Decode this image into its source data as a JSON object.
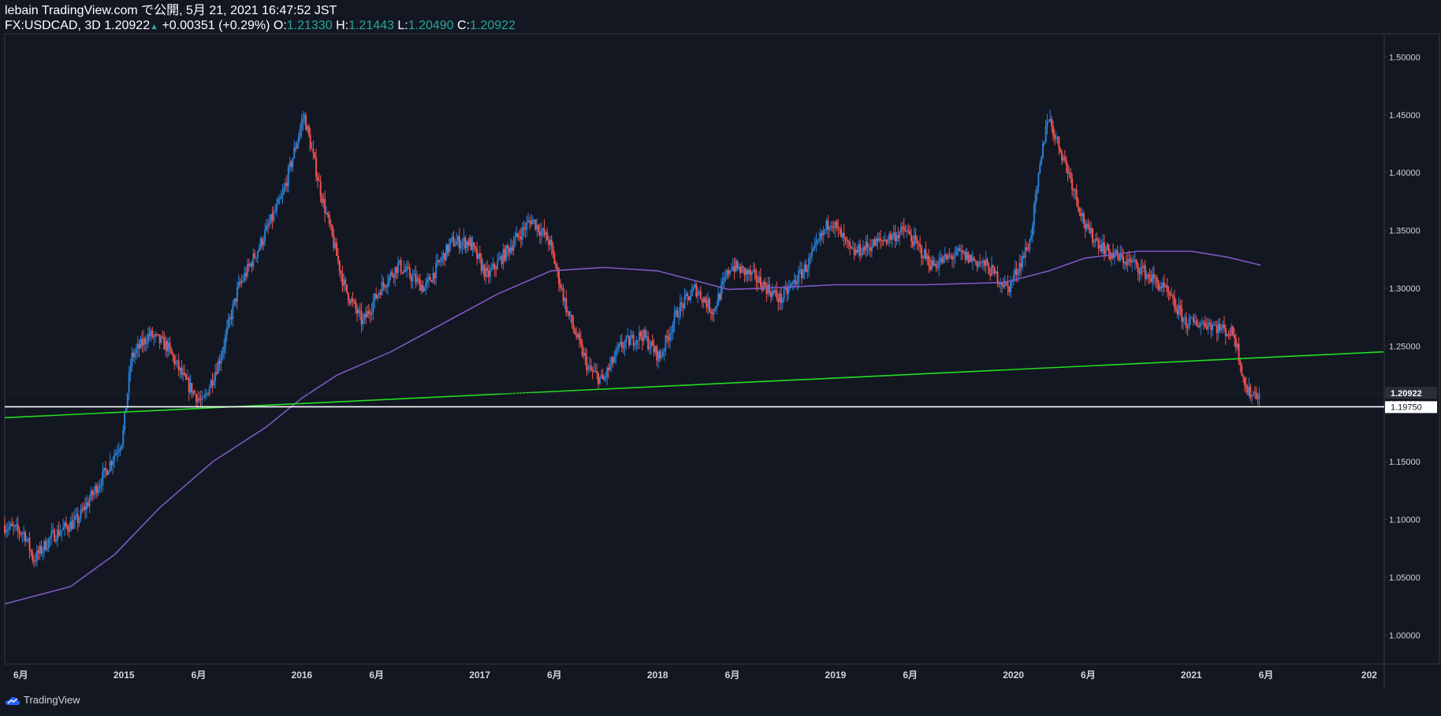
{
  "header": {
    "line1": "lebain TradingView.com で公開, 5月 21, 2021 16:47:52 JST",
    "symbol": "FX:USDCAD, 3D",
    "last": "1.20922",
    "change": "+0.00351 (+0.29%)",
    "o_label": "O:",
    "o_value": "1.21330",
    "h_label": "H:",
    "h_value": "1.21443",
    "l_label": "L:",
    "l_value": "1.20490",
    "c_label": "C:",
    "c_value": "1.20922"
  },
  "footer": {
    "brand": "TradingView"
  },
  "colors": {
    "background": "#131722",
    "up": "#2a7fd4",
    "down": "#ef5350",
    "ma": "#7e57c2",
    "trendline": "#22dd22",
    "support": "#ffffff",
    "axis_text": "#d1d4dc"
  },
  "chart_data": {
    "type": "candlestick",
    "ylim": [
      0.975,
      1.52
    ],
    "y_ticks": [
      "1.50000",
      "1.45000",
      "1.40000",
      "1.35000",
      "1.30000",
      "1.25000",
      "1.20000",
      "1.15000",
      "1.10000",
      "1.05000",
      "1.00000"
    ],
    "y_tick_values": [
      1.5,
      1.45,
      1.4,
      1.35,
      1.3,
      1.25,
      1.2,
      1.15,
      1.1,
      1.05,
      1.0
    ],
    "x_range": [
      2014.33,
      2022.08
    ],
    "x_ticks": [
      {
        "label": "6月",
        "x": 2014.42
      },
      {
        "label": "2015",
        "x": 2015.0
      },
      {
        "label": "6月",
        "x": 2015.42
      },
      {
        "label": "2016",
        "x": 2016.0
      },
      {
        "label": "6月",
        "x": 2016.42
      },
      {
        "label": "2017",
        "x": 2017.0
      },
      {
        "label": "6月",
        "x": 2017.42
      },
      {
        "label": "2018",
        "x": 2018.0
      },
      {
        "label": "6月",
        "x": 2018.42
      },
      {
        "label": "2019",
        "x": 2019.0
      },
      {
        "label": "6月",
        "x": 2019.42
      },
      {
        "label": "2020",
        "x": 2020.0
      },
      {
        "label": "6月",
        "x": 2020.42
      },
      {
        "label": "2021",
        "x": 2021.0
      },
      {
        "label": "6月",
        "x": 2021.42
      },
      {
        "label": "202",
        "x": 2022.0
      }
    ],
    "price_path": [
      [
        2014.33,
        1.095
      ],
      [
        2014.45,
        1.088
      ],
      [
        2014.5,
        1.065
      ],
      [
        2014.6,
        1.085
      ],
      [
        2014.75,
        1.1
      ],
      [
        2014.9,
        1.14
      ],
      [
        2015.0,
        1.17
      ],
      [
        2015.05,
        1.24
      ],
      [
        2015.15,
        1.26
      ],
      [
        2015.25,
        1.25
      ],
      [
        2015.35,
        1.22
      ],
      [
        2015.45,
        1.2
      ],
      [
        2015.55,
        1.24
      ],
      [
        2015.65,
        1.3
      ],
      [
        2015.75,
        1.33
      ],
      [
        2015.9,
        1.38
      ],
      [
        2016.02,
        1.45
      ],
      [
        2016.12,
        1.38
      ],
      [
        2016.25,
        1.3
      ],
      [
        2016.35,
        1.27
      ],
      [
        2016.45,
        1.3
      ],
      [
        2016.55,
        1.32
      ],
      [
        2016.7,
        1.3
      ],
      [
        2016.85,
        1.34
      ],
      [
        2016.95,
        1.34
      ],
      [
        2017.05,
        1.31
      ],
      [
        2017.15,
        1.33
      ],
      [
        2017.3,
        1.36
      ],
      [
        2017.4,
        1.34
      ],
      [
        2017.5,
        1.28
      ],
      [
        2017.62,
        1.23
      ],
      [
        2017.7,
        1.22
      ],
      [
        2017.8,
        1.25
      ],
      [
        2017.92,
        1.26
      ],
      [
        2018.02,
        1.24
      ],
      [
        2018.12,
        1.28
      ],
      [
        2018.22,
        1.3
      ],
      [
        2018.32,
        1.28
      ],
      [
        2018.42,
        1.32
      ],
      [
        2018.55,
        1.31
      ],
      [
        2018.7,
        1.29
      ],
      [
        2018.85,
        1.32
      ],
      [
        2018.98,
        1.36
      ],
      [
        2019.1,
        1.33
      ],
      [
        2019.25,
        1.34
      ],
      [
        2019.4,
        1.35
      ],
      [
        2019.55,
        1.32
      ],
      [
        2019.7,
        1.33
      ],
      [
        2019.85,
        1.32
      ],
      [
        2019.98,
        1.3
      ],
      [
        2020.1,
        1.34
      ],
      [
        2020.2,
        1.45
      ],
      [
        2020.32,
        1.4
      ],
      [
        2020.42,
        1.35
      ],
      [
        2020.55,
        1.33
      ],
      [
        2020.7,
        1.32
      ],
      [
        2020.85,
        1.3
      ],
      [
        2020.98,
        1.27
      ],
      [
        2021.1,
        1.27
      ],
      [
        2021.25,
        1.26
      ],
      [
        2021.32,
        1.21
      ],
      [
        2021.39,
        1.209
      ]
    ],
    "moving_average": [
      [
        2014.33,
        1.027
      ],
      [
        2014.7,
        1.042
      ],
      [
        2014.95,
        1.07
      ],
      [
        2015.2,
        1.11
      ],
      [
        2015.5,
        1.15
      ],
      [
        2015.8,
        1.18
      ],
      [
        2016.0,
        1.205
      ],
      [
        2016.2,
        1.225
      ],
      [
        2016.5,
        1.245
      ],
      [
        2016.8,
        1.27
      ],
      [
        2017.1,
        1.295
      ],
      [
        2017.4,
        1.315
      ],
      [
        2017.7,
        1.318
      ],
      [
        2018.0,
        1.315
      ],
      [
        2018.25,
        1.305
      ],
      [
        2018.4,
        1.299
      ],
      [
        2018.6,
        1.3
      ],
      [
        2019.0,
        1.303
      ],
      [
        2019.5,
        1.303
      ],
      [
        2019.95,
        1.305
      ],
      [
        2020.2,
        1.315
      ],
      [
        2020.4,
        1.326
      ],
      [
        2020.7,
        1.332
      ],
      [
        2021.0,
        1.332
      ],
      [
        2021.2,
        1.327
      ],
      [
        2021.39,
        1.32
      ]
    ],
    "trendline": [
      [
        2014.33,
        1.188
      ],
      [
        2022.08,
        1.245
      ]
    ],
    "support_level": 1.1975,
    "current_price": 1.20922,
    "labels": {
      "current": "1.20922",
      "support": "1.19750"
    }
  }
}
